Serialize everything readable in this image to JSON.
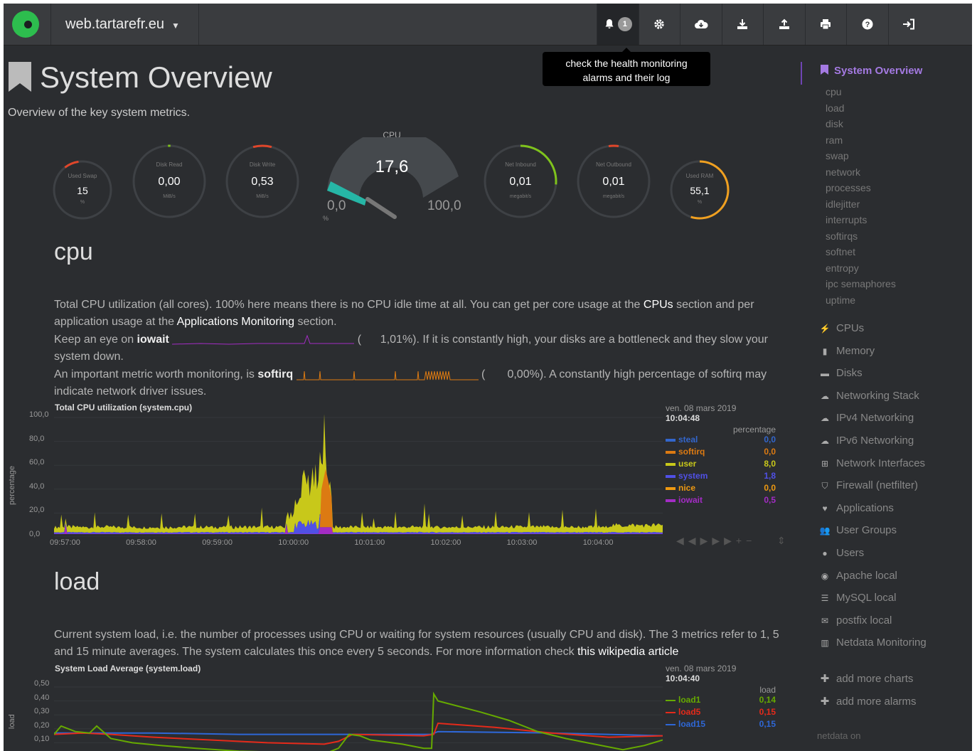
{
  "navbar": {
    "hostname": "web.tartarefr.eu",
    "alarm_count": "1",
    "tooltip_line1": "check the health monitoring",
    "tooltip_line2": "alarms and their log"
  },
  "header": {
    "title": "System Overview",
    "subtitle": "Overview of the key system metrics."
  },
  "gauges": [
    {
      "label": "Used Swap",
      "value": "15",
      "unit": "%"
    },
    {
      "label": "Disk Read",
      "value": "0,00",
      "unit": "MiB/s"
    },
    {
      "label": "Disk Write",
      "value": "0,53",
      "unit": "MiB/s"
    },
    {
      "label": "Net Inbound",
      "value": "0,01",
      "unit": "megabit/s"
    },
    {
      "label": "Net Outbound",
      "value": "0,01",
      "unit": "megabit/s"
    },
    {
      "label": "Used RAM",
      "value": "55,1",
      "unit": "%"
    }
  ],
  "cpu_gauge": {
    "title": "CPU",
    "value": "17,6",
    "min": "0,0",
    "max": "100,0",
    "unit": "%"
  },
  "cpu_section": {
    "title": "cpu",
    "p1a": "Total CPU utilization (all cores). 100% here means there is no CPU idle time at all. You can get per core usage at the ",
    "p1_link1": "CPUs",
    "p1b": " section and per application usage at the ",
    "p1_link2": "Applications Monitoring",
    "p1c": " section.",
    "p2a": "Keep an eye on ",
    "p2_bold": "iowait",
    "p2_val": "1,01%",
    "p2b": "). If it is constantly high, your disks are a bottleneck and they slow your system down.",
    "p3a": "An important metric worth monitoring, is ",
    "p3_bold": "softirq",
    "p3_val": "0,00%",
    "p3b": "). A constantly high percentage of softirq may indicate network driver issues."
  },
  "load_section": {
    "title": "load",
    "p1": "Current system load, i.e. the number of processes using CPU or waiting for system resources (usually CPU and disk). The 3 metrics refer to 1, 5 and 15 minute averages. The system calculates this once every 5 seconds. For more information check ",
    "p1_link": "this wikipedia article"
  },
  "chart_data": [
    {
      "type": "area",
      "title": "Total CPU utilization (system.cpu)",
      "ylabel": "percentage",
      "ylim": [
        0,
        100
      ],
      "yticks": [
        "100,0",
        "80,0",
        "60,0",
        "40,0",
        "20,0",
        "0,0"
      ],
      "xticks": [
        "09:57:00",
        "09:58:00",
        "09:59:00",
        "10:00:00",
        "10:01:00",
        "10:02:00",
        "10:03:00",
        "10:04:00"
      ],
      "legend_date": "ven. 08 mars 2019",
      "legend_time": "10:04:48",
      "legend_unit": "percentage",
      "series": [
        {
          "name": "steal",
          "value": "0,0",
          "color": "#3366cc"
        },
        {
          "name": "softirq",
          "value": "0,0",
          "color": "#dc7a12"
        },
        {
          "name": "user",
          "value": "8,0",
          "color": "#c8c81a"
        },
        {
          "name": "system",
          "value": "1,8",
          "color": "#5050e6"
        },
        {
          "name": "nice",
          "value": "0,0",
          "color": "#ee9911"
        },
        {
          "name": "iowait",
          "value": "0,5",
          "color": "#a32cc4"
        }
      ]
    },
    {
      "type": "line",
      "title": "System Load Average (system.load)",
      "ylabel": "load",
      "yticks": [
        "0,50",
        "0,40",
        "0,30",
        "0,20",
        "0,10"
      ],
      "legend_date": "ven. 08 mars 2019",
      "legend_time": "10:04:40",
      "legend_unit": "load",
      "series": [
        {
          "name": "load1",
          "value": "0,14",
          "color": "#66aa00"
        },
        {
          "name": "load5",
          "value": "0,15",
          "color": "#e52a1a"
        },
        {
          "name": "load15",
          "value": "0,15",
          "color": "#2e67d6"
        }
      ]
    }
  ],
  "sidebar": {
    "header": "System Overview",
    "subitems": [
      "cpu",
      "load",
      "disk",
      "ram",
      "swap",
      "network",
      "processes",
      "idlejitter",
      "interrupts",
      "softirqs",
      "softnet",
      "entropy",
      "ipc semaphores",
      "uptime"
    ],
    "items": [
      {
        "label": "CPUs",
        "icon": "bolt-icon"
      },
      {
        "label": "Memory",
        "icon": "memory-icon"
      },
      {
        "label": "Disks",
        "icon": "disk-icon"
      },
      {
        "label": "Networking Stack",
        "icon": "cloud-icon"
      },
      {
        "label": "IPv4 Networking",
        "icon": "cloud-icon"
      },
      {
        "label": "IPv6 Networking",
        "icon": "cloud-icon"
      },
      {
        "label": "Network Interfaces",
        "icon": "sitemap-icon"
      },
      {
        "label": "Firewall (netfilter)",
        "icon": "shield-icon"
      },
      {
        "label": "Applications",
        "icon": "heartbeat-icon"
      },
      {
        "label": "User Groups",
        "icon": "users-icon"
      },
      {
        "label": "Users",
        "icon": "user-icon"
      },
      {
        "label": "Apache local",
        "icon": "eye-icon"
      },
      {
        "label": "MySQL local",
        "icon": "database-icon"
      },
      {
        "label": "postfix local",
        "icon": "envelope-icon"
      },
      {
        "label": "Netdata Monitoring",
        "icon": "chart-icon"
      }
    ],
    "add_charts": "add more charts",
    "add_alarms": "add more alarms",
    "footer": "netdata on"
  }
}
